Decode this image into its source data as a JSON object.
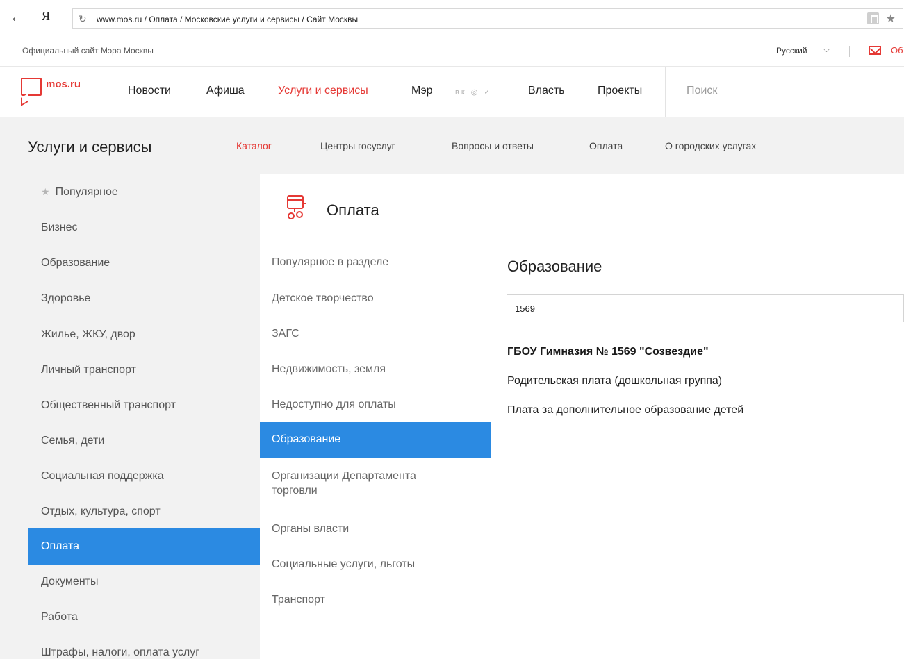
{
  "browser": {
    "back_glyph": "←",
    "yandex_glyph": "Я",
    "reload_glyph": "↻",
    "url": "www.mos.ru  / Оплата / Московские услуги и сервисы / Сайт Москвы",
    "star_glyph": "★"
  },
  "topbar": {
    "official_text": "Официальный сайт Мэра Москвы",
    "language": "Русский",
    "lang_chevron": "⌵",
    "mail_text": "Об"
  },
  "header": {
    "logo_text": "mos.ru",
    "nav": [
      "Новости",
      "Афиша",
      "Услуги и сервисы",
      "Мэр",
      "Власть",
      "Проекты"
    ],
    "social": "вк ◎ ✓",
    "search_placeholder": "Поиск"
  },
  "section": {
    "title": "Услуги и сервисы",
    "subnav": [
      "Каталог",
      "Центры госуслуг",
      "Вопросы и ответы",
      "Оплата",
      "О городских услугах"
    ]
  },
  "sidebar": {
    "star_glyph": "★",
    "items": [
      "Популярное",
      "Бизнес",
      "Образование",
      "Здоровье",
      "Жилье, ЖКУ, двор",
      "Личный транспорт",
      "Общественный транспорт",
      "Семья, дети",
      "Социальная поддержка",
      "Отдых, культура, спорт",
      "Оплата",
      "Документы",
      "Работа",
      "Штрафы, налоги, оплата услуг"
    ]
  },
  "pane": {
    "title": "Оплата"
  },
  "categories": {
    "items": [
      "Популярное в разделе",
      "Детское творчество",
      "ЗАГС",
      "Недвижимость, земля",
      "Недоступно для оплаты",
      "Образование",
      "Организации Департамента торговли",
      "Органы власти",
      "Социальные услуги, льготы",
      "Транспорт"
    ]
  },
  "detail": {
    "title": "Образование",
    "search_value": "1569",
    "result_group": "ГБОУ Гимназия № 1569 \"Созвездие\"",
    "results": [
      "Родительская плата (дошкольная группа)",
      "Плата за дополнительное образование детей"
    ]
  },
  "colors": {
    "brand_red": "#e53935",
    "active_blue": "#2b8ae2",
    "panel_gray": "#f2f2f2"
  }
}
